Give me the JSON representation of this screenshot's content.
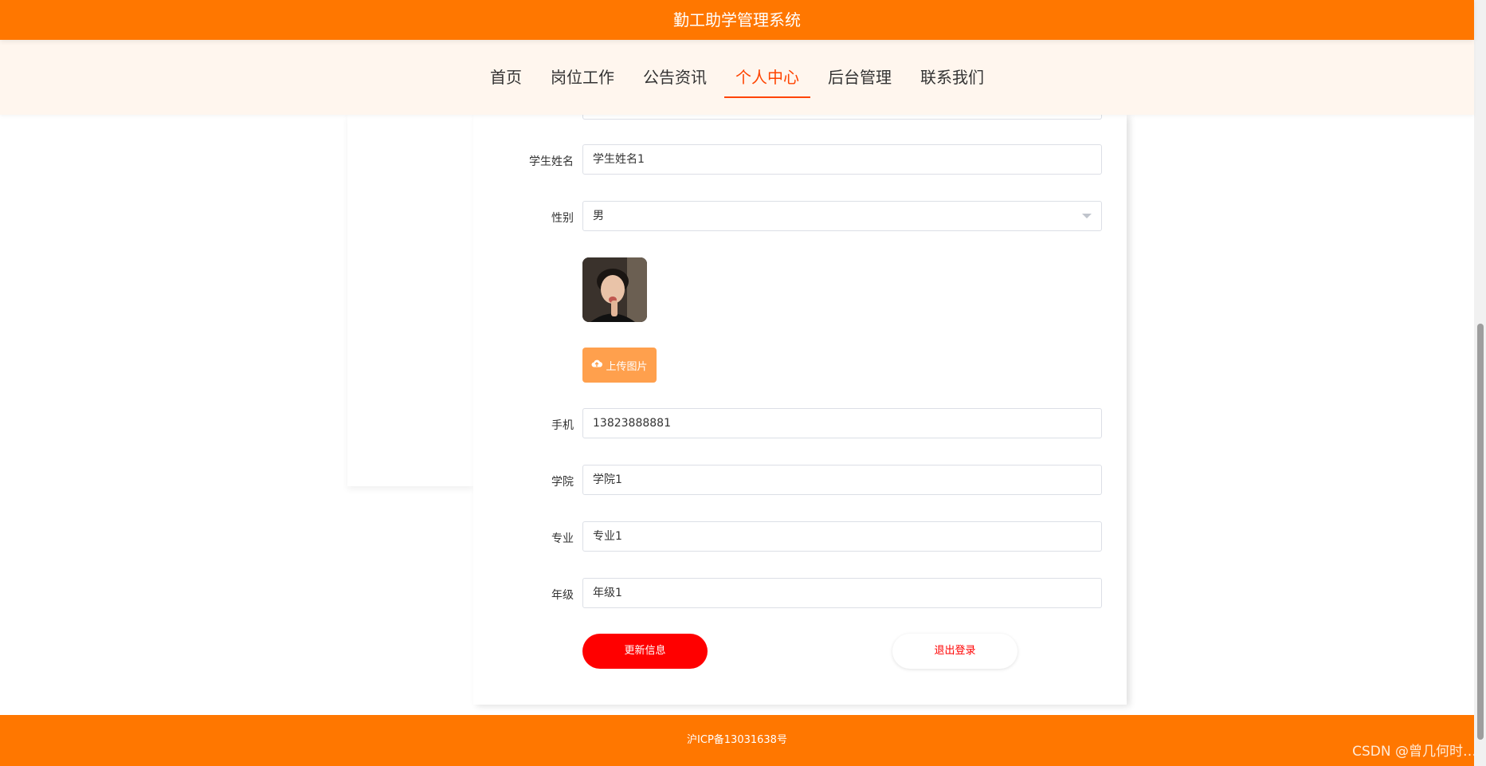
{
  "header": {
    "title": "勤工助学管理系统"
  },
  "nav": {
    "items": [
      {
        "label": "首页"
      },
      {
        "label": "岗位工作"
      },
      {
        "label": "公告资讯"
      },
      {
        "label": "个人中心"
      },
      {
        "label": "后台管理"
      },
      {
        "label": "联系我们"
      }
    ],
    "active": "个人中心"
  },
  "form": {
    "student_name": {
      "label": "学生姓名",
      "value": "学生姓名1"
    },
    "gender": {
      "label": "性别",
      "value": "男"
    },
    "upload_button": "上传图片",
    "phone": {
      "label": "手机",
      "value": "13823888881"
    },
    "college": {
      "label": "学院",
      "value": "学院1"
    },
    "major": {
      "label": "专业",
      "value": "专业1"
    },
    "grade": {
      "label": "年级",
      "value": "年级1"
    },
    "update_button": "更新信息",
    "logout_button": "退出登录"
  },
  "footer": {
    "icp": "沪ICP备13031638号"
  },
  "watermark": "CSDN @曾几何时…",
  "colors": {
    "brand_orange": "#ff7700",
    "nav_bg": "#fff6ee",
    "active_nav": "#ff4400",
    "primary_red": "#ff0000",
    "upload_orange": "#ffa04d"
  },
  "icons": {
    "upload": "cloud-upload-icon",
    "select": "chevron-down-icon"
  }
}
